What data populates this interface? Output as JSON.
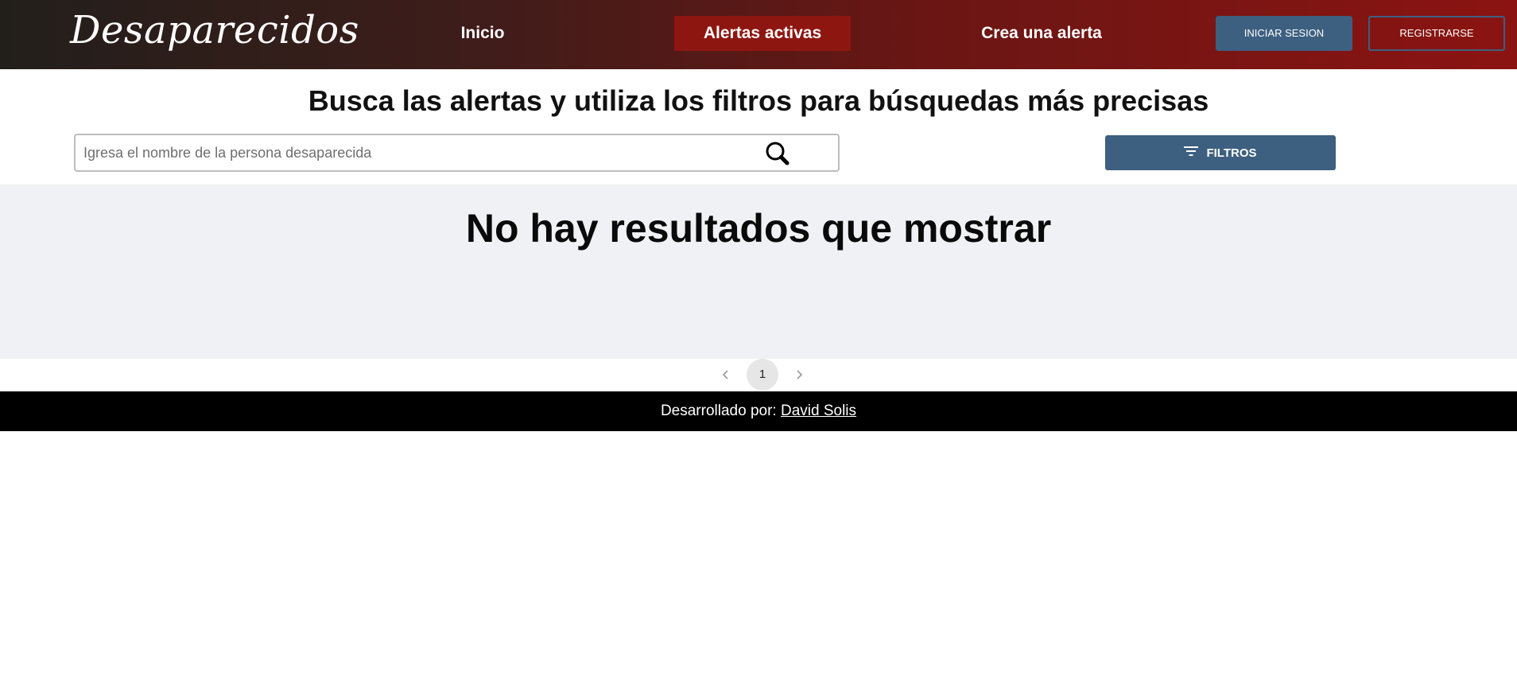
{
  "brand": {
    "name": "Desaparecidos"
  },
  "nav": {
    "items": [
      {
        "label": "Inicio"
      },
      {
        "label": "Alertas activas"
      },
      {
        "label": "Crea una alerta"
      }
    ],
    "login_label": "INICIAR SESION",
    "register_label": "REGISTRARSE"
  },
  "main": {
    "title": "Busca las alertas y utiliza los filtros para búsquedas más precisas",
    "search": {
      "placeholder": "Igresa el nombre de la persona desaparecida",
      "value": ""
    },
    "filter_label": "FILTROS",
    "empty_message": "No hay resultados que mostrar"
  },
  "pagination": {
    "current_page": "1"
  },
  "footer": {
    "prefix": "Desarrollado por:",
    "author": "David Solis"
  },
  "colors": {
    "nav_active": "#8e1611",
    "primary_button": "#3d5f80",
    "results_background": "#f0f1f4",
    "footer_background": "#000000"
  },
  "icons": [
    "search-icon",
    "filter-icon",
    "chevron-left-icon",
    "chevron-right-icon"
  ]
}
